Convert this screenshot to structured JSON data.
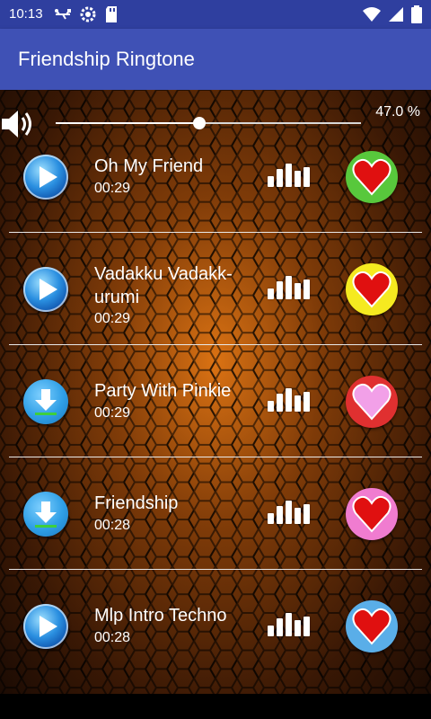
{
  "status_bar": {
    "time": "10:13"
  },
  "app_bar": {
    "title": "Friendship Ringtone"
  },
  "volume": {
    "percent_label": "47.0 %",
    "level": 0.47
  },
  "colors": {
    "app_bar": "#3f51b5",
    "status_bar": "#2f3f9f"
  },
  "ringtones": [
    {
      "title": "Oh My Friend",
      "duration": "00:29",
      "action_icon": "play-icon",
      "favorite_bg": "#58c83c",
      "heart_color": "#e01010"
    },
    {
      "title": "Vadakku Vadakk-urumi",
      "duration": "00:29",
      "action_icon": "play-icon",
      "favorite_bg": "#f5ea20",
      "heart_color": "#e01010"
    },
    {
      "title": "Party With Pinkie",
      "duration": "00:29",
      "action_icon": "download-icon",
      "favorite_bg": "#e03030",
      "heart_color": "#f2a0e8"
    },
    {
      "title": "Friendship",
      "duration": "00:28",
      "action_icon": "download-icon",
      "favorite_bg": "#f07cd0",
      "heart_color": "#e01010"
    },
    {
      "title": "Mlp Intro Techno",
      "duration": "00:28",
      "action_icon": "play-icon",
      "favorite_bg": "#5aaee8",
      "heart_color": "#e01010"
    }
  ]
}
